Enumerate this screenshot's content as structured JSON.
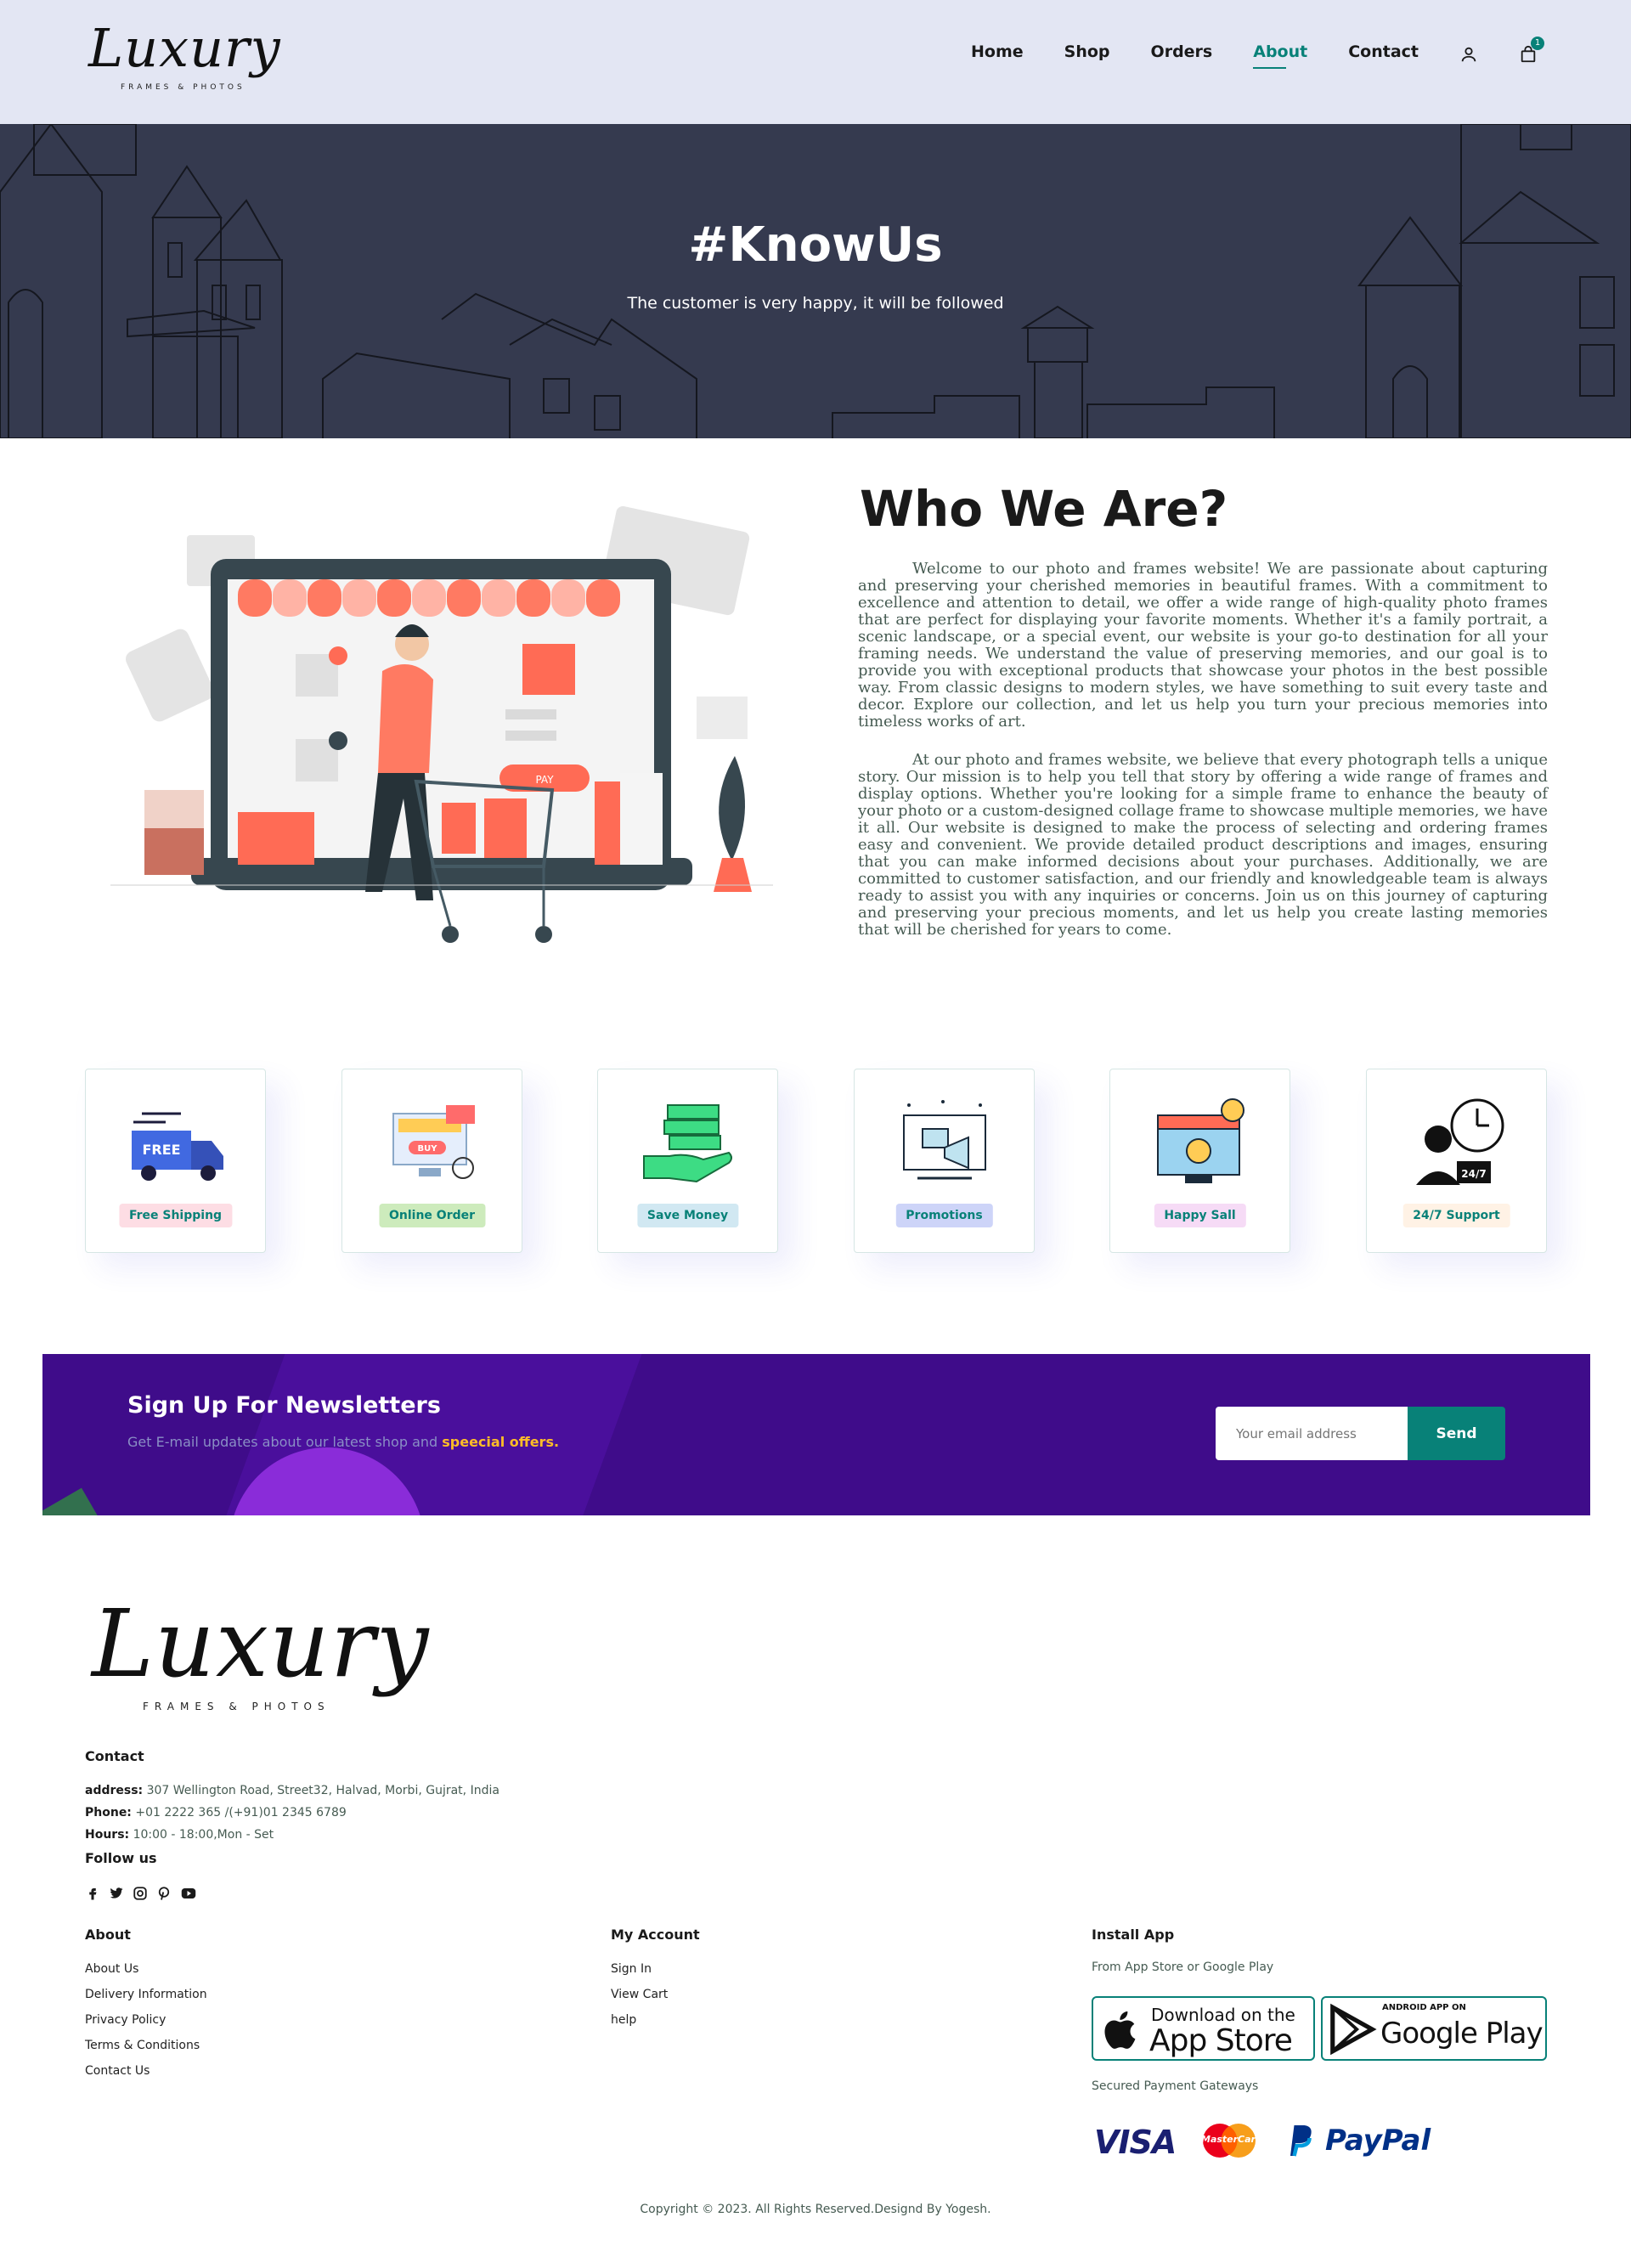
{
  "brand": {
    "name": "Luxury",
    "tagline": "FRAMES & PHOTOS"
  },
  "nav": {
    "items": [
      {
        "label": "Home",
        "active": false
      },
      {
        "label": "Shop",
        "active": false
      },
      {
        "label": "Orders",
        "active": false
      },
      {
        "label": "About",
        "active": true
      },
      {
        "label": "Contact",
        "active": false
      }
    ],
    "user_icon": "user-icon",
    "cart_icon": "shopping-bag-icon",
    "cart_count": "1"
  },
  "hero": {
    "title": "#KnowUs",
    "subtitle": "The customer is very happy, it will be followed"
  },
  "about": {
    "title": "Who We Are?",
    "paragraph1": "Welcome to our photo and frames website! We are passionate about capturing and preserving your cherished memories in beautiful frames. With a commitment to excellence and attention to detail, we offer a wide range of high-quality photo frames that are perfect for displaying your favorite moments. Whether it's a family portrait, a scenic landscape, or a special event, our website is your go-to destination for all your framing needs. We understand the value of preserving memories, and our goal is to provide you with exceptional products that showcase your photos in the best possible way. From classic designs to modern styles, we have something to suit every taste and decor. Explore our collection, and let us help you turn your precious memories into timeless works of art.",
    "paragraph2": "At our photo and frames website, we believe that every photograph tells a unique story. Our mission is to help you tell that story by offering a wide range of frames and display options. Whether you're looking for a simple frame to enhance the beauty of your photo or a custom-designed collage frame to showcase multiple memories, we have it all. Our website is designed to make the process of selecting and ordering frames easy and convenient. We provide detailed product descriptions and images, ensuring that you can make informed decisions about your purchases. Additionally, we are committed to customer satisfaction, and our friendly and knowledgeable team is always ready to assist you with any inquiries or concerns. Join us on this journey of capturing and preserving your precious moments, and let us help you create lasting memories that will be cherished for years to come.",
    "illustration_labels": {
      "pay": "PAY"
    }
  },
  "features": [
    {
      "label": "Free Shipping",
      "icon": "free-shipping-truck-icon",
      "bg": "#fddde4",
      "icon_text": "FREE"
    },
    {
      "label": "Online Order",
      "icon": "online-order-icon",
      "bg": "#cdebbc",
      "icon_text": "BUY"
    },
    {
      "label": "Save Money",
      "icon": "save-money-icon",
      "bg": "#d1e8f2"
    },
    {
      "label": "Promotions",
      "icon": "promotions-icon",
      "bg": "#cdd4f8"
    },
    {
      "label": "Happy Sall",
      "icon": "happy-sell-icon",
      "bg": "#f6dbf6"
    },
    {
      "label": "24/7 Support",
      "icon": "support-icon",
      "bg": "#fff2e5",
      "icon_text": "24/7"
    }
  ],
  "newsletter": {
    "title": "Sign Up For Newsletters",
    "subtitle_prefix": "Get E-mail updates about our latest shop and ",
    "subtitle_highlight": "speecial offers.",
    "email_placeholder": "Your email address",
    "button_label": "Send"
  },
  "footer": {
    "contact": {
      "heading": "Contact",
      "address_label": "address:",
      "address": " 307 Wellington Road, Street32, Halvad, Morbi, Gujrat, India",
      "phone_label": "Phone:",
      "phone": " +01 2222 365 /(+91)01 2345 6789",
      "hours_label": "Hours:",
      "hours": " 10:00 - 18:00,Mon - Set"
    },
    "follow": {
      "heading": "Follow us",
      "icons": [
        "facebook-icon",
        "twitter-icon",
        "instagram-icon",
        "pinterest-icon",
        "youtube-icon"
      ]
    },
    "about": {
      "heading": "About",
      "links": [
        "About Us",
        "Delivery Information",
        "Privacy Policy",
        "Terms & Conditions",
        "Contact Us"
      ]
    },
    "account": {
      "heading": "My Account",
      "links": [
        "Sign In",
        "View Cart",
        "help"
      ]
    },
    "install": {
      "heading": "Install App",
      "subtitle": "From App Store or Google Play",
      "app_store_top": "Download on the",
      "app_store_bottom": "App Store",
      "google_play_top": "ANDROID APP ON",
      "google_play_bottom": "Google Play",
      "payment_heading": "Secured Payment Gateways",
      "payment_visa": "VISA",
      "payment_mastercard": "MasterCard",
      "payment_paypal": "PayPal"
    },
    "copyright": "Copyright © 2023. All Rights Reserved.Designd By Yogesh."
  }
}
